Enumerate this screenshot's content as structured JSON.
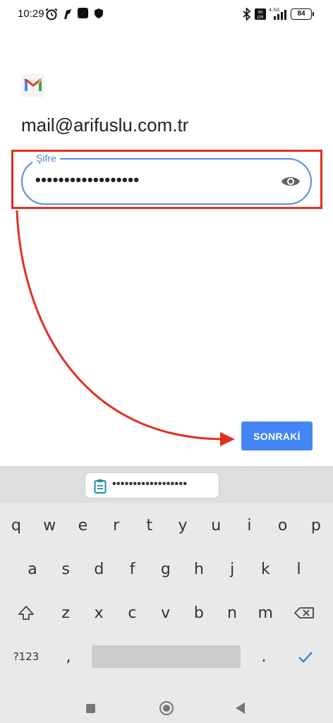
{
  "status_bar": {
    "time": "10:29",
    "network": "4.5G",
    "volte": "Vo LTE",
    "battery": "84",
    "icons": [
      "alarm-icon",
      "app-notification-icon",
      "app-notification-icon",
      "shield-icon",
      "bluetooth-icon",
      "signal-icon"
    ]
  },
  "login": {
    "app_icon": "gmail-logo",
    "email": "mail@arifuslu.com.tr",
    "password_label": "Şifre",
    "password_value": "••••••••••••••••••",
    "next_button": "SONRAKİ"
  },
  "keyboard": {
    "clipboard_suggestion": "••••••••••••••••••",
    "row1": [
      "q",
      "w",
      "e",
      "r",
      "t",
      "y",
      "u",
      "i",
      "o",
      "p"
    ],
    "row2": [
      "a",
      "s",
      "d",
      "f",
      "g",
      "h",
      "j",
      "k",
      "l"
    ],
    "row3": [
      "z",
      "x",
      "c",
      "v",
      "b",
      "n",
      "m"
    ],
    "symbols_key": "?123",
    "comma_key": ",",
    "period_key": ".",
    "icons": [
      "shift-icon",
      "backspace-icon",
      "checkmark-icon",
      "clipboard-icon"
    ]
  },
  "colors": {
    "accent_blue": "#4285f4",
    "field_border": "#5b8ed8",
    "annotation_red": "#e0301e"
  }
}
